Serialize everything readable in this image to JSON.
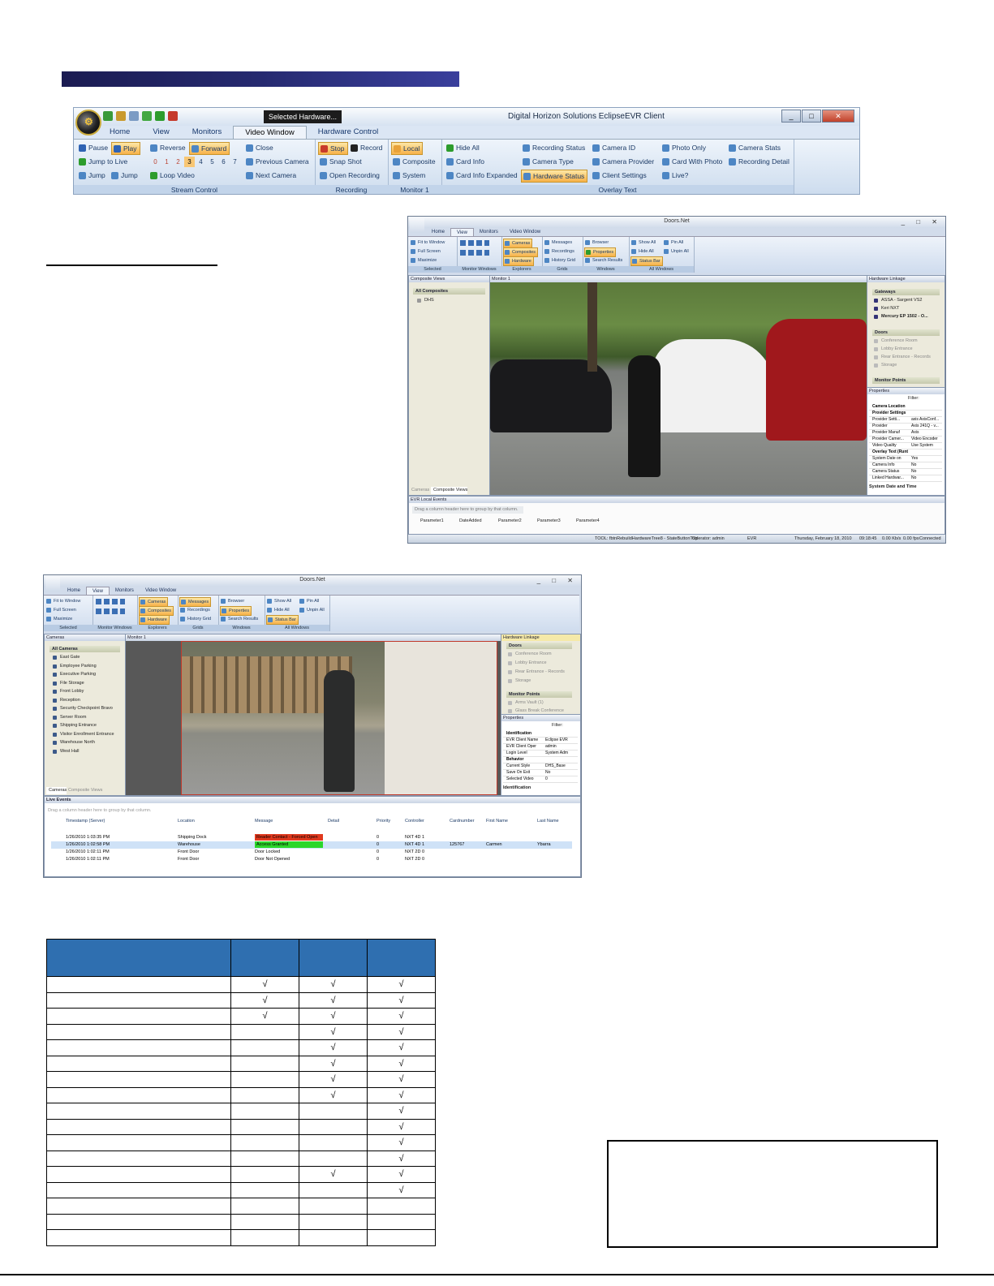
{
  "ribbon": {
    "context_tab": "Selected   Hardware...",
    "window_title": "Digital Horizon Solutions EclipseEVR Client",
    "tabs": [
      "Home",
      "View",
      "Monitors",
      "Video Window",
      "Hardware Control"
    ],
    "active_tab": "Video Window",
    "stream_control": {
      "pause": "Pause",
      "play": "Play",
      "reverse": "Reverse",
      "forward": "Forward",
      "jump_to_live": "Jump to Live",
      "jump_back": "Jump",
      "jump_forward": "Jump",
      "loop_video": "Loop Video",
      "speeds": [
        "0",
        "1",
        "2",
        "3",
        "4",
        "5",
        "6",
        "7"
      ],
      "label": "Stream Control"
    },
    "camera_nav": {
      "close": "Close",
      "previous": "Previous Camera",
      "next": "Next Camera"
    },
    "recording": {
      "stop": "Stop",
      "record": "Record",
      "snap_shot": "Snap Shot",
      "open_recording": "Open Recording",
      "label": "Recording"
    },
    "monitor": {
      "local": "Local",
      "composite": "Composite",
      "system": "System",
      "label": "Monitor 1"
    },
    "overlay": {
      "hide_all": "Hide All",
      "card_info": "Card Info",
      "card_info_expanded": "Card Info Expanded",
      "recording_status": "Recording Status",
      "camera_type": "Camera Type",
      "hardware_status": "Hardware Status",
      "camera_id": "Camera ID",
      "camera_provider": "Camera Provider",
      "client_settings": "Client Settings",
      "photo_only": "Photo Only",
      "card_with_photo": "Card With Photo",
      "live": "Live?",
      "camera_stats": "Camera Stats",
      "recording_detail": "Recording Detail",
      "label": "Overlay Text"
    }
  },
  "app1": {
    "title": "Doors.Net",
    "tabs": [
      "Home",
      "View",
      "Monitors",
      "Video Window"
    ],
    "ribbon": {
      "fit_to_window": "Fit to Window",
      "full_screen": "Full Screen",
      "maximize": "Maximize",
      "selected": "Selected",
      "monitor_windows": "Monitor Windows",
      "cameras": "Cameras",
      "composites": "Composites",
      "hardware": "Hardware",
      "explorers": "Explorers",
      "messages": "Messages",
      "recordings": "Recordings",
      "history_grid": "History Grid",
      "grids": "Grids",
      "browser": "Browser",
      "properties": "Properties",
      "search_results": "Search Results",
      "windows": "Windows",
      "show_all": "Show All",
      "hide_all": "Hide All",
      "status_bar": "Status Bar",
      "pin_all": "Pin All",
      "unpin_all": "Unpin All",
      "all_windows": "All Windows"
    },
    "composite_views": "Composite Views",
    "all_composites": "All Composites",
    "composite_item": "DHS",
    "bottom_tabs": [
      "Cameras",
      "Composite Views"
    ],
    "monitor": "Monitor 1",
    "hardware_linkage": "Hardware Linkage",
    "gateways": "Gateways",
    "gateway_items": [
      "ASSA - Sargent VS2",
      "Keri NXT",
      "Mercury EP 1502 - O..."
    ],
    "doors": "Doors",
    "door_items": [
      "Conference Room",
      "Lobby Entrance",
      "Rear Entrance - Records",
      "Storage"
    ],
    "monitor_points": "Monitor Points",
    "properties": "Properties",
    "filter": "Filter:",
    "prop_rows": [
      [
        "Camera Location",
        ""
      ],
      [
        "Provider Settings",
        ""
      ],
      [
        "Provider Setti...",
        "axis AxisConf..."
      ],
      [
        "Provider",
        "Axis 241Q - v..."
      ],
      [
        "Provider Manuf",
        "Axis"
      ],
      [
        "Provider Camer...",
        "Video Encoder"
      ],
      [
        "Video Quality",
        "Use System"
      ],
      [
        "Overlay Text (Runtime)",
        ""
      ],
      [
        "System Date on",
        "Yes"
      ],
      [
        "Camera Info",
        "No"
      ],
      [
        "Camera Status",
        "No"
      ],
      [
        "Linked Hardwar...",
        "No"
      ]
    ],
    "prop_desc": "System Date and Time",
    "events_title": "EVR Local Events",
    "drag_hint": "Drag a column header here to group by that column.",
    "event_cols": [
      "Parameter1",
      "DateAdded",
      "Parameter2",
      "Parameter3",
      "Parameter4"
    ],
    "status": [
      "TOOL: fbtnRebuildHardwareTree8 - StateButtonTool",
      "Operator: admin",
      "EVR",
      "Thursday, February 18, 2010",
      "09:18:45",
      "0.00 Kb/s",
      "0.00 fps",
      "Connected"
    ]
  },
  "app2": {
    "title": "Doors.Net",
    "tabs": [
      "Home",
      "View",
      "Monitors",
      "Video Window"
    ],
    "cameras_pane": "Cameras",
    "all_cameras": "All Cameras",
    "camera_items": [
      "East Gate",
      "Employee Parking",
      "Executive Parking",
      "File Storage",
      "Front Lobby",
      "Reception",
      "Security Checkpoint Bravo",
      "Server Room",
      "Shipping Entrance",
      "Visitor Enrollment Entrance",
      "Warehouse North",
      "West Hall"
    ],
    "bottom_tabs": [
      "Cameras",
      "Composite Views"
    ],
    "monitor": "Monitor 1",
    "hardware_linkage": "Hardware Linkage",
    "doors": "Doors",
    "door_items": [
      "Conference Room",
      "Lobby Entrance",
      "Rear Entrance - Records",
      "Storage"
    ],
    "monitor_points": "Monitor Points",
    "mp_items": [
      "Arms Vault (1)",
      "Glass Break Conference"
    ],
    "properties": "Properties",
    "filter": "Filter:",
    "prop_rows": [
      [
        "Identification",
        ""
      ],
      [
        "EVR Client Name",
        "Eclipse EVR"
      ],
      [
        "EVR Client Oper",
        "admin"
      ],
      [
        "Login Level",
        "System Adm"
      ],
      [
        "Behavior",
        ""
      ],
      [
        "Current Style",
        "DHS_Base"
      ],
      [
        "Save On Exit",
        "No"
      ],
      [
        "Selected Video",
        "0"
      ]
    ],
    "prop_desc": "Identification",
    "events_title": "Live Events",
    "drag_hint": "Drag a column header here to group by that column.",
    "event_cols": [
      "Timestamp (Server)",
      "Location",
      "Message",
      "Detail",
      "Priority",
      "Controller",
      "Cardnumber",
      "First Name",
      "Last Name"
    ],
    "events": [
      [
        "1/26/2010 1:03:35 PM",
        "Shipping Dock",
        "Reader Contact - Forced Open",
        "",
        "0",
        "NXT 4D 1",
        "",
        "",
        ""
      ],
      [
        "1/26/2010 1:02:58 PM",
        "Warehouse",
        "Access Granted",
        "",
        "0",
        "NXT 4D 1",
        "125767",
        "Carmen",
        "Ybarra"
      ],
      [
        "1/26/2010 1:02:11 PM",
        "Front Door",
        "Door Locked",
        "",
        "0",
        "NXT 2D 0",
        "",
        "",
        ""
      ],
      [
        "1/26/2010 1:02:11 PM",
        "Front Door",
        "Door Not Opened",
        "",
        "0",
        "NXT 2D 0",
        "",
        "",
        ""
      ]
    ],
    "event_colors": [
      "#e0391e",
      "#2bd62b"
    ]
  },
  "table": {
    "header_color": "#2f6fb0",
    "check": "√",
    "rows": [
      [
        "",
        "√",
        "√",
        "√"
      ],
      [
        "",
        "√",
        "√",
        "√"
      ],
      [
        "",
        "√",
        "√",
        "√"
      ],
      [
        "",
        "",
        "√",
        "√"
      ],
      [
        "",
        "",
        "√",
        "√"
      ],
      [
        "",
        "",
        "√",
        "√"
      ],
      [
        "",
        "",
        "√",
        "√"
      ],
      [
        "",
        "",
        "√",
        "√"
      ],
      [
        "",
        "",
        "",
        "√"
      ],
      [
        "",
        "",
        "",
        "√"
      ],
      [
        "",
        "",
        "",
        "√"
      ],
      [
        "",
        "",
        "",
        "√"
      ],
      [
        "",
        "",
        "√",
        "√"
      ],
      [
        "",
        "",
        "",
        "√"
      ],
      [
        "",
        "",
        "",
        ""
      ],
      [
        "",
        "",
        "",
        ""
      ],
      [
        "",
        "",
        "",
        ""
      ]
    ]
  },
  "colors": {
    "header_bar": "#262a70",
    "highlight": "#f7b148",
    "accent": "#4d86c4"
  }
}
